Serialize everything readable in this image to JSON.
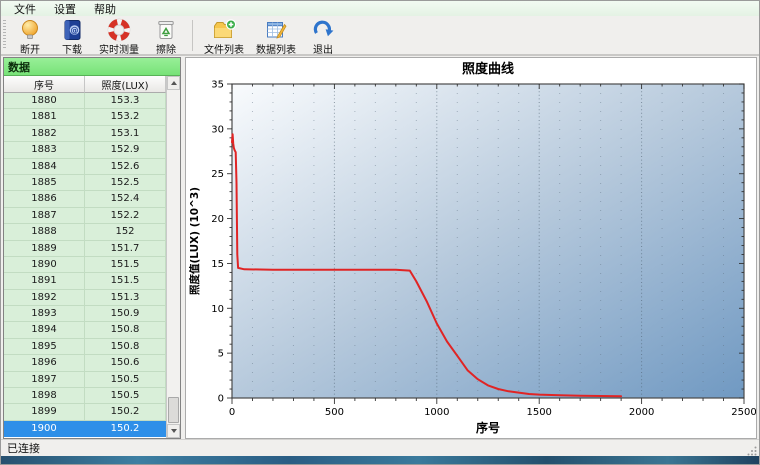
{
  "menubar": {
    "items": [
      "文件",
      "设置",
      "帮助"
    ]
  },
  "toolbar": {
    "buttons": [
      {
        "label": "断开",
        "icon": "bulb-icon"
      },
      {
        "label": "下载",
        "icon": "book-icon"
      },
      {
        "label": "实时测量",
        "icon": "lifebuoy-icon"
      },
      {
        "label": "擦除",
        "icon": "trash-icon"
      },
      {
        "label": "文件列表",
        "icon": "folder-add-icon",
        "sep_before": true
      },
      {
        "label": "数据列表",
        "icon": "table-edit-icon"
      },
      {
        "label": "退出",
        "icon": "redo-arrow-icon"
      }
    ]
  },
  "data_panel": {
    "title": "数据",
    "columns": [
      "序号",
      "照度(LUX)"
    ],
    "rows": [
      [
        "1880",
        "153.3"
      ],
      [
        "1881",
        "153.2"
      ],
      [
        "1882",
        "153.1"
      ],
      [
        "1883",
        "152.9"
      ],
      [
        "1884",
        "152.6"
      ],
      [
        "1885",
        "152.5"
      ],
      [
        "1886",
        "152.4"
      ],
      [
        "1887",
        "152.2"
      ],
      [
        "1888",
        "152"
      ],
      [
        "1889",
        "151.7"
      ],
      [
        "1890",
        "151.5"
      ],
      [
        "1891",
        "151.5"
      ],
      [
        "1892",
        "151.3"
      ],
      [
        "1893",
        "150.9"
      ],
      [
        "1894",
        "150.8"
      ],
      [
        "1895",
        "150.8"
      ],
      [
        "1896",
        "150.6"
      ],
      [
        "1897",
        "150.5"
      ],
      [
        "1898",
        "150.5"
      ],
      [
        "1899",
        "150.2"
      ],
      [
        "1900",
        "150.2"
      ]
    ],
    "selected_row": "1900"
  },
  "statusbar": {
    "text": "已连接"
  },
  "chart_data": {
    "type": "line",
    "title": "照度曲线",
    "xlabel": "序号",
    "ylabel": "照度值(LUX) (10^3)",
    "xlim": [
      0,
      2500
    ],
    "ylim": [
      0,
      35
    ],
    "x_major_step": 500,
    "x_minor_step": 100,
    "y_major_step": 5,
    "y_minor_step": 1,
    "grid": "dotted-vertical",
    "legend": "none",
    "line_color": "#e02424",
    "bg_gradient": [
      "#f9fbfd",
      "#b6c9dc",
      "#7099c2"
    ],
    "series": [
      {
        "name": "照度",
        "points": [
          [
            0,
            28.5
          ],
          [
            3,
            29.4
          ],
          [
            6,
            28.4
          ],
          [
            9,
            27.9
          ],
          [
            13,
            27.6
          ],
          [
            18,
            27.4
          ],
          [
            22,
            24.0
          ],
          [
            26,
            16.0
          ],
          [
            30,
            14.5
          ],
          [
            60,
            14.35
          ],
          [
            200,
            14.3
          ],
          [
            400,
            14.3
          ],
          [
            600,
            14.3
          ],
          [
            800,
            14.3
          ],
          [
            868,
            14.2
          ],
          [
            900,
            13.0
          ],
          [
            950,
            10.8
          ],
          [
            1000,
            8.3
          ],
          [
            1050,
            6.3
          ],
          [
            1100,
            4.7
          ],
          [
            1150,
            3.1
          ],
          [
            1200,
            2.1
          ],
          [
            1250,
            1.4
          ],
          [
            1300,
            1.0
          ],
          [
            1350,
            0.75
          ],
          [
            1400,
            0.6
          ],
          [
            1450,
            0.45
          ],
          [
            1500,
            0.38
          ],
          [
            1600,
            0.3
          ],
          [
            1700,
            0.25
          ],
          [
            1800,
            0.22
          ],
          [
            1900,
            0.2
          ]
        ]
      }
    ]
  }
}
